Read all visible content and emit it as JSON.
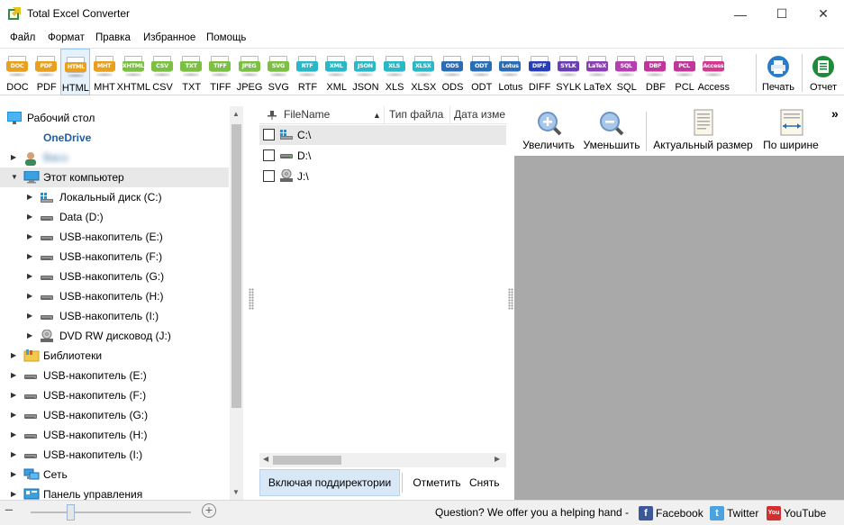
{
  "window": {
    "title": "Total Excel Converter",
    "controls": {
      "minimize": "—",
      "maximize": "☐",
      "close": "✕"
    }
  },
  "menu": [
    "Файл",
    "Формат",
    "Правка",
    "Избранное",
    "Помощь"
  ],
  "formats": [
    {
      "tag": "DOC",
      "label": "DOC",
      "color": "#e8a020"
    },
    {
      "tag": "PDF",
      "label": "PDF",
      "color": "#e8a020"
    },
    {
      "tag": "HTML",
      "label": "HTML",
      "color": "#e8a020"
    },
    {
      "tag": "MHT",
      "label": "MHT",
      "color": "#e8a020"
    },
    {
      "tag": "XHTML",
      "label": "XHTML",
      "color": "#7bc043"
    },
    {
      "tag": "CSV",
      "label": "CSV",
      "color": "#7bc043"
    },
    {
      "tag": "TXT",
      "label": "TXT",
      "color": "#7bc043"
    },
    {
      "tag": "TIFF",
      "label": "TIFF",
      "color": "#7bc043"
    },
    {
      "tag": "JPEG",
      "label": "JPEG",
      "color": "#7bc043"
    },
    {
      "tag": "SVG",
      "label": "SVG",
      "color": "#7bc043"
    },
    {
      "tag": "RTF",
      "label": "RTF",
      "color": "#2ab7c6"
    },
    {
      "tag": "XML",
      "label": "XML",
      "color": "#2ab7c6"
    },
    {
      "tag": "JSON",
      "label": "JSON",
      "color": "#2ab7c6"
    },
    {
      "tag": "XLS",
      "label": "XLS",
      "color": "#2ab7c6"
    },
    {
      "tag": "XLSX",
      "label": "XLSX",
      "color": "#2ab7c6"
    },
    {
      "tag": "ODS",
      "label": "ODS",
      "color": "#2a6db5"
    },
    {
      "tag": "ODT",
      "label": "ODT",
      "color": "#2a6db5"
    },
    {
      "tag": "Lotus",
      "label": "Lotus",
      "color": "#2a6db5"
    },
    {
      "tag": "DIFF",
      "label": "DIFF",
      "color": "#2a3fb5"
    },
    {
      "tag": "SYLK",
      "label": "SYLK",
      "color": "#6a3fb5"
    },
    {
      "tag": "LaTeX",
      "label": "LaTeX",
      "color": "#8a3fb5"
    },
    {
      "tag": "SQL",
      "label": "SQL",
      "color": "#b53fb0"
    },
    {
      "tag": "DBF",
      "label": "DBF",
      "color": "#c0369a"
    },
    {
      "tag": "PCL",
      "label": "PCL",
      "color": "#c0369a"
    },
    {
      "tag": "Access",
      "label": "Access",
      "color": "#d03a8f"
    }
  ],
  "selected_format": "HTML",
  "toolbar_extra": {
    "print": "Печать",
    "report": "Отчет"
  },
  "tree": [
    {
      "label": "Рабочий стол",
      "level": 0,
      "arrow": "",
      "icon": "desktop-icon"
    },
    {
      "label": "OneDrive",
      "level": 0,
      "arrow": "",
      "icon": "onedrive-icon",
      "bold": true
    },
    {
      "label": "Васо",
      "level": 0,
      "arrow": "▶",
      "icon": "user-icon",
      "blur": true
    },
    {
      "label": "Этот компьютер",
      "level": 0,
      "arrow": "▼",
      "icon": "computer-icon",
      "highlight": true
    },
    {
      "label": "Локальный диск (C:)",
      "level": 1,
      "arrow": "▶",
      "icon": "windows-drive-icon"
    },
    {
      "label": "Data (D:)",
      "level": 1,
      "arrow": "▶",
      "icon": "drive-icon"
    },
    {
      "label": "USB-накопитель (E:)",
      "level": 1,
      "arrow": "▶",
      "icon": "drive-icon"
    },
    {
      "label": "USB-накопитель (F:)",
      "level": 1,
      "arrow": "▶",
      "icon": "drive-icon"
    },
    {
      "label": "USB-накопитель (G:)",
      "level": 1,
      "arrow": "▶",
      "icon": "drive-icon"
    },
    {
      "label": "USB-накопитель (H:)",
      "level": 1,
      "arrow": "▶",
      "icon": "drive-icon"
    },
    {
      "label": "USB-накопитель (I:)",
      "level": 1,
      "arrow": "▶",
      "icon": "drive-icon"
    },
    {
      "label": "DVD RW дисковод (J:)",
      "level": 1,
      "arrow": "▶",
      "icon": "dvd-icon"
    },
    {
      "label": "Библиотеки",
      "level": 0,
      "arrow": "▶",
      "icon": "library-icon"
    },
    {
      "label": "USB-накопитель (E:)",
      "level": 0,
      "arrow": "▶",
      "icon": "drive-icon"
    },
    {
      "label": "USB-накопитель (F:)",
      "level": 0,
      "arrow": "▶",
      "icon": "drive-icon"
    },
    {
      "label": "USB-накопитель (G:)",
      "level": 0,
      "arrow": "▶",
      "icon": "drive-icon"
    },
    {
      "label": "USB-накопитель (H:)",
      "level": 0,
      "arrow": "▶",
      "icon": "drive-icon"
    },
    {
      "label": "USB-накопитель (I:)",
      "level": 0,
      "arrow": "▶",
      "icon": "drive-icon"
    },
    {
      "label": "Сеть",
      "level": 0,
      "arrow": "▶",
      "icon": "network-icon"
    },
    {
      "label": "Панель управления",
      "level": 0,
      "arrow": "▶",
      "icon": "control-panel-icon"
    }
  ],
  "filelist": {
    "columns": [
      "FileName",
      "Тип файла",
      "Дата изме"
    ],
    "rows": [
      {
        "name": "C:\\",
        "icon": "windows-drive-icon",
        "selected": true
      },
      {
        "name": "D:\\",
        "icon": "drive-icon",
        "selected": false
      },
      {
        "name": "J:\\",
        "icon": "dvd-icon",
        "selected": false
      }
    ],
    "buttons": {
      "include_subdirs": "Включая поддиректории",
      "check": "Отметить",
      "uncheck": "Снять"
    }
  },
  "preview_toolbar": {
    "zoom_in": "Увеличить",
    "zoom_out": "Уменьшить",
    "actual_size": "Актуальный размер",
    "fit_width": "По ширине",
    "more": "»"
  },
  "status": {
    "question": "Question? We offer you a helping hand -",
    "facebook": "Facebook",
    "twitter": "Twitter",
    "youtube": "YouTube",
    "zoom_minus": "−",
    "zoom_plus": "+"
  }
}
